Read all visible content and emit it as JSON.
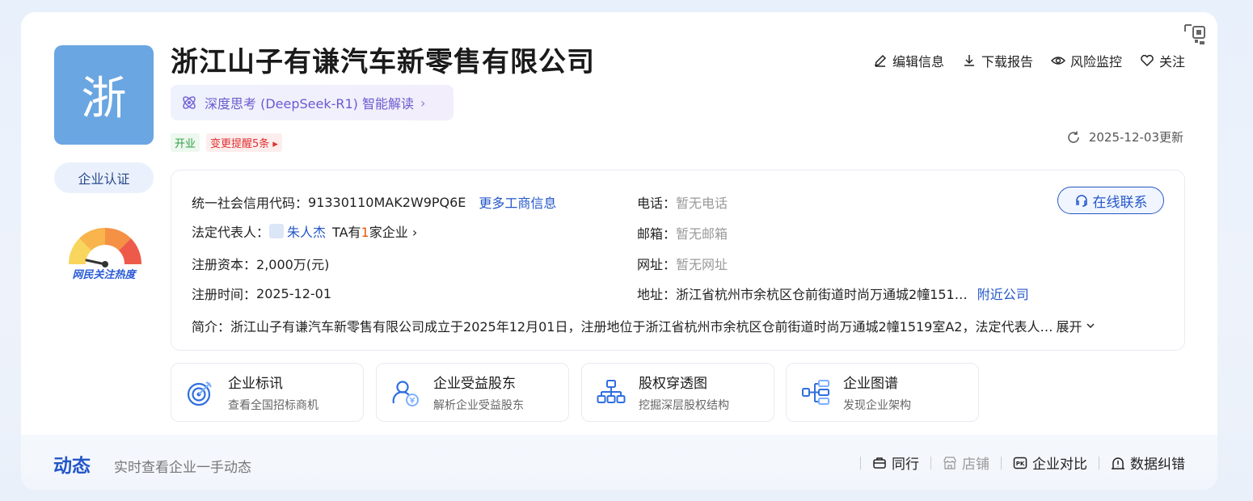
{
  "company": {
    "logo_char": "浙",
    "name": "浙江山子有谦汽车新零售有限公司",
    "certification": "企业认证",
    "heat_label": "网民关注热度"
  },
  "ai_reading": {
    "label": "深度思考 (DeepSeek-R1) 智能解读",
    "chevron": "›"
  },
  "tags": {
    "status": "开业",
    "change": "变更提醒5条 ▸"
  },
  "actions": {
    "edit": "编辑信息",
    "download": "下载报告",
    "monitor": "风险监控",
    "follow": "关注"
  },
  "updated": "2025-12-03更新",
  "info": {
    "credit_code_label": "统一社会信用代码：",
    "credit_code": "91330110MAK2W9PQ6E",
    "more_info": "更多工商信息",
    "rep_label": "法定代表人：",
    "rep_name": "朱人杰",
    "rep_ta_prefix": "TA有",
    "rep_count": "1",
    "rep_ta_suffix": "家企业",
    "rep_chevron": "›",
    "capital_label": "注册资本：",
    "capital": "2,000万(元)",
    "reg_date_label": "注册时间：",
    "reg_date": "2025-12-01",
    "phone_label": "电话：",
    "phone": "暂无电话",
    "email_label": "邮箱：",
    "email": "暂无邮箱",
    "website_label": "网址：",
    "website": "暂无网址",
    "address_label": "地址：",
    "address": "浙江省杭州市余杭区仓前街道时尚万通城2幢151…",
    "nearby": "附近公司",
    "contact_button": "在线联系",
    "intro_label": "简介：",
    "intro": "浙江山子有谦汽车新零售有限公司成立于2025年12月01日，注册地位于浙江省杭州市余杭区仓前街道时尚万通城2幢1519室A2，法定代表人…",
    "expand": "展开"
  },
  "features": [
    {
      "title": "企业标讯",
      "subtitle": "查看全国招标商机",
      "icon": "target-icon"
    },
    {
      "title": "企业受益股东",
      "subtitle": "解析企业受益股东",
      "icon": "beneficiary-icon"
    },
    {
      "title": "股权穿透图",
      "subtitle": "挖掘深层股权结构",
      "icon": "equity-tree-icon"
    },
    {
      "title": "企业图谱",
      "subtitle": "发现企业架构",
      "icon": "org-graph-icon"
    }
  ],
  "dynamics": {
    "title": "动态",
    "subtitle": "实时查看企业一手动态"
  },
  "bottom_actions": {
    "peers": "同行",
    "store": "店铺",
    "compare": "企业对比",
    "correction": "数据纠错"
  },
  "colors": {
    "brand_blue": "#2456c8",
    "logo_bg": "#6aa6e2",
    "status_green": "#2f9e44",
    "alert_red": "#e03131"
  }
}
